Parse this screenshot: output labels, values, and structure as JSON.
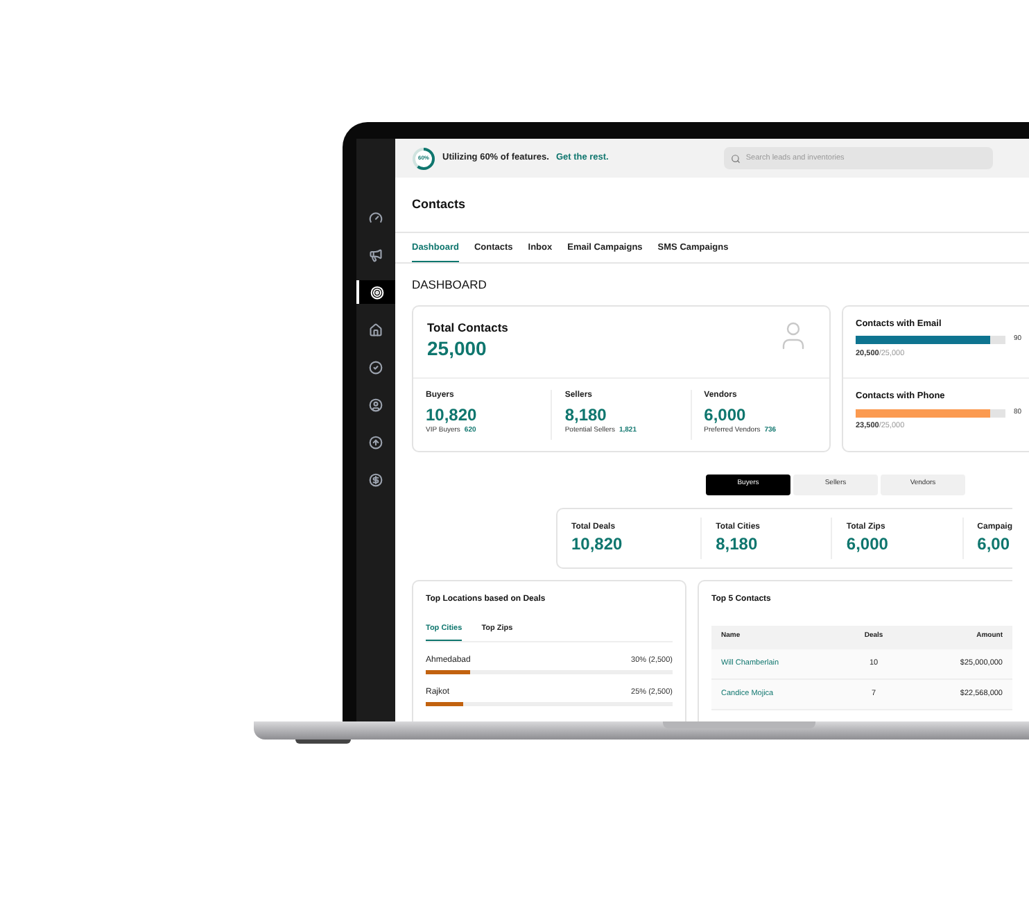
{
  "sidebar": {
    "items": [
      {
        "kind": "gauge",
        "selected": false
      },
      {
        "kind": "megaphone",
        "selected": false
      },
      {
        "kind": "target",
        "selected": true
      },
      {
        "kind": "home",
        "selected": false
      },
      {
        "kind": "check",
        "selected": false
      },
      {
        "kind": "user",
        "selected": false
      },
      {
        "kind": "upload",
        "selected": false
      },
      {
        "kind": "dollar",
        "selected": false
      }
    ]
  },
  "top_bar": {
    "usage_badge": "60%",
    "usage_ring": {
      "level": 0.6
    },
    "usage_text": "Utilizing 60% of features.",
    "usage_link": "Get the rest.",
    "search": {
      "placeholder": "Search leads and inventories"
    }
  },
  "page_title": "Contacts",
  "tabs": [
    {
      "label": "Dashboard",
      "selected": true
    },
    {
      "label": "Contacts",
      "selected": false
    },
    {
      "label": "Inbox",
      "selected": false
    },
    {
      "label": "Email Campaigns",
      "selected": false
    },
    {
      "label": "SMS Campaigns",
      "selected": false
    }
  ],
  "section_title": "DASHBOARD",
  "total_contacts": {
    "label": "Total Contacts",
    "value": "25,000",
    "groups": [
      {
        "label": "Buyers",
        "value": "10,820",
        "sub_label": "VIP Buyers",
        "sub_value": "620"
      },
      {
        "label": "Sellers",
        "value": "8,180",
        "sub_label": "Potential Sellers",
        "sub_value": "1,821"
      },
      {
        "label": "Vendors",
        "value": "6,000",
        "sub_label": "Preferred Vendors",
        "sub_value": "736"
      }
    ]
  },
  "coverage": [
    {
      "label": "Contacts with Email",
      "level": 0.9,
      "color": "#0e7490",
      "percent": "90",
      "count": "20,500",
      "total": "/25,000"
    },
    {
      "label": "Contacts with Phone",
      "level": 0.9,
      "color": "#fb9a50",
      "percent": "80",
      "count": "23,500",
      "total": "/25,000"
    }
  ],
  "segments": [
    {
      "label": "Buyers",
      "selected": true
    },
    {
      "label": "Sellers",
      "selected": false
    },
    {
      "label": "Vendors",
      "selected": false
    }
  ],
  "stats": [
    {
      "label": "Total Deals",
      "value": "10,820"
    },
    {
      "label": "Total Cities",
      "value": "8,180"
    },
    {
      "label": "Total Zips",
      "value": "6,000"
    },
    {
      "label": "Campaig",
      "value": "6,00"
    }
  ],
  "top_locations": {
    "title": "Top Locations based on Deals",
    "tabs": [
      {
        "label": "Top Cities",
        "selected": true
      },
      {
        "label": "Top Zips",
        "selected": false
      }
    ],
    "rows": [
      {
        "name": "Ahmedabad",
        "reading": "30% (2,500)",
        "level": 0.18
      },
      {
        "name": "Rajkot",
        "reading": "25% (2,500)",
        "level": 0.15
      }
    ]
  },
  "top_contacts": {
    "title": "Top 5 Contacts",
    "columns": [
      "Name",
      "Deals",
      "Amount"
    ],
    "rows": [
      [
        "Will Chamberlain",
        "10",
        "$25,000,000"
      ],
      [
        "Candice Mojica",
        "7",
        "$22,568,000"
      ]
    ]
  }
}
